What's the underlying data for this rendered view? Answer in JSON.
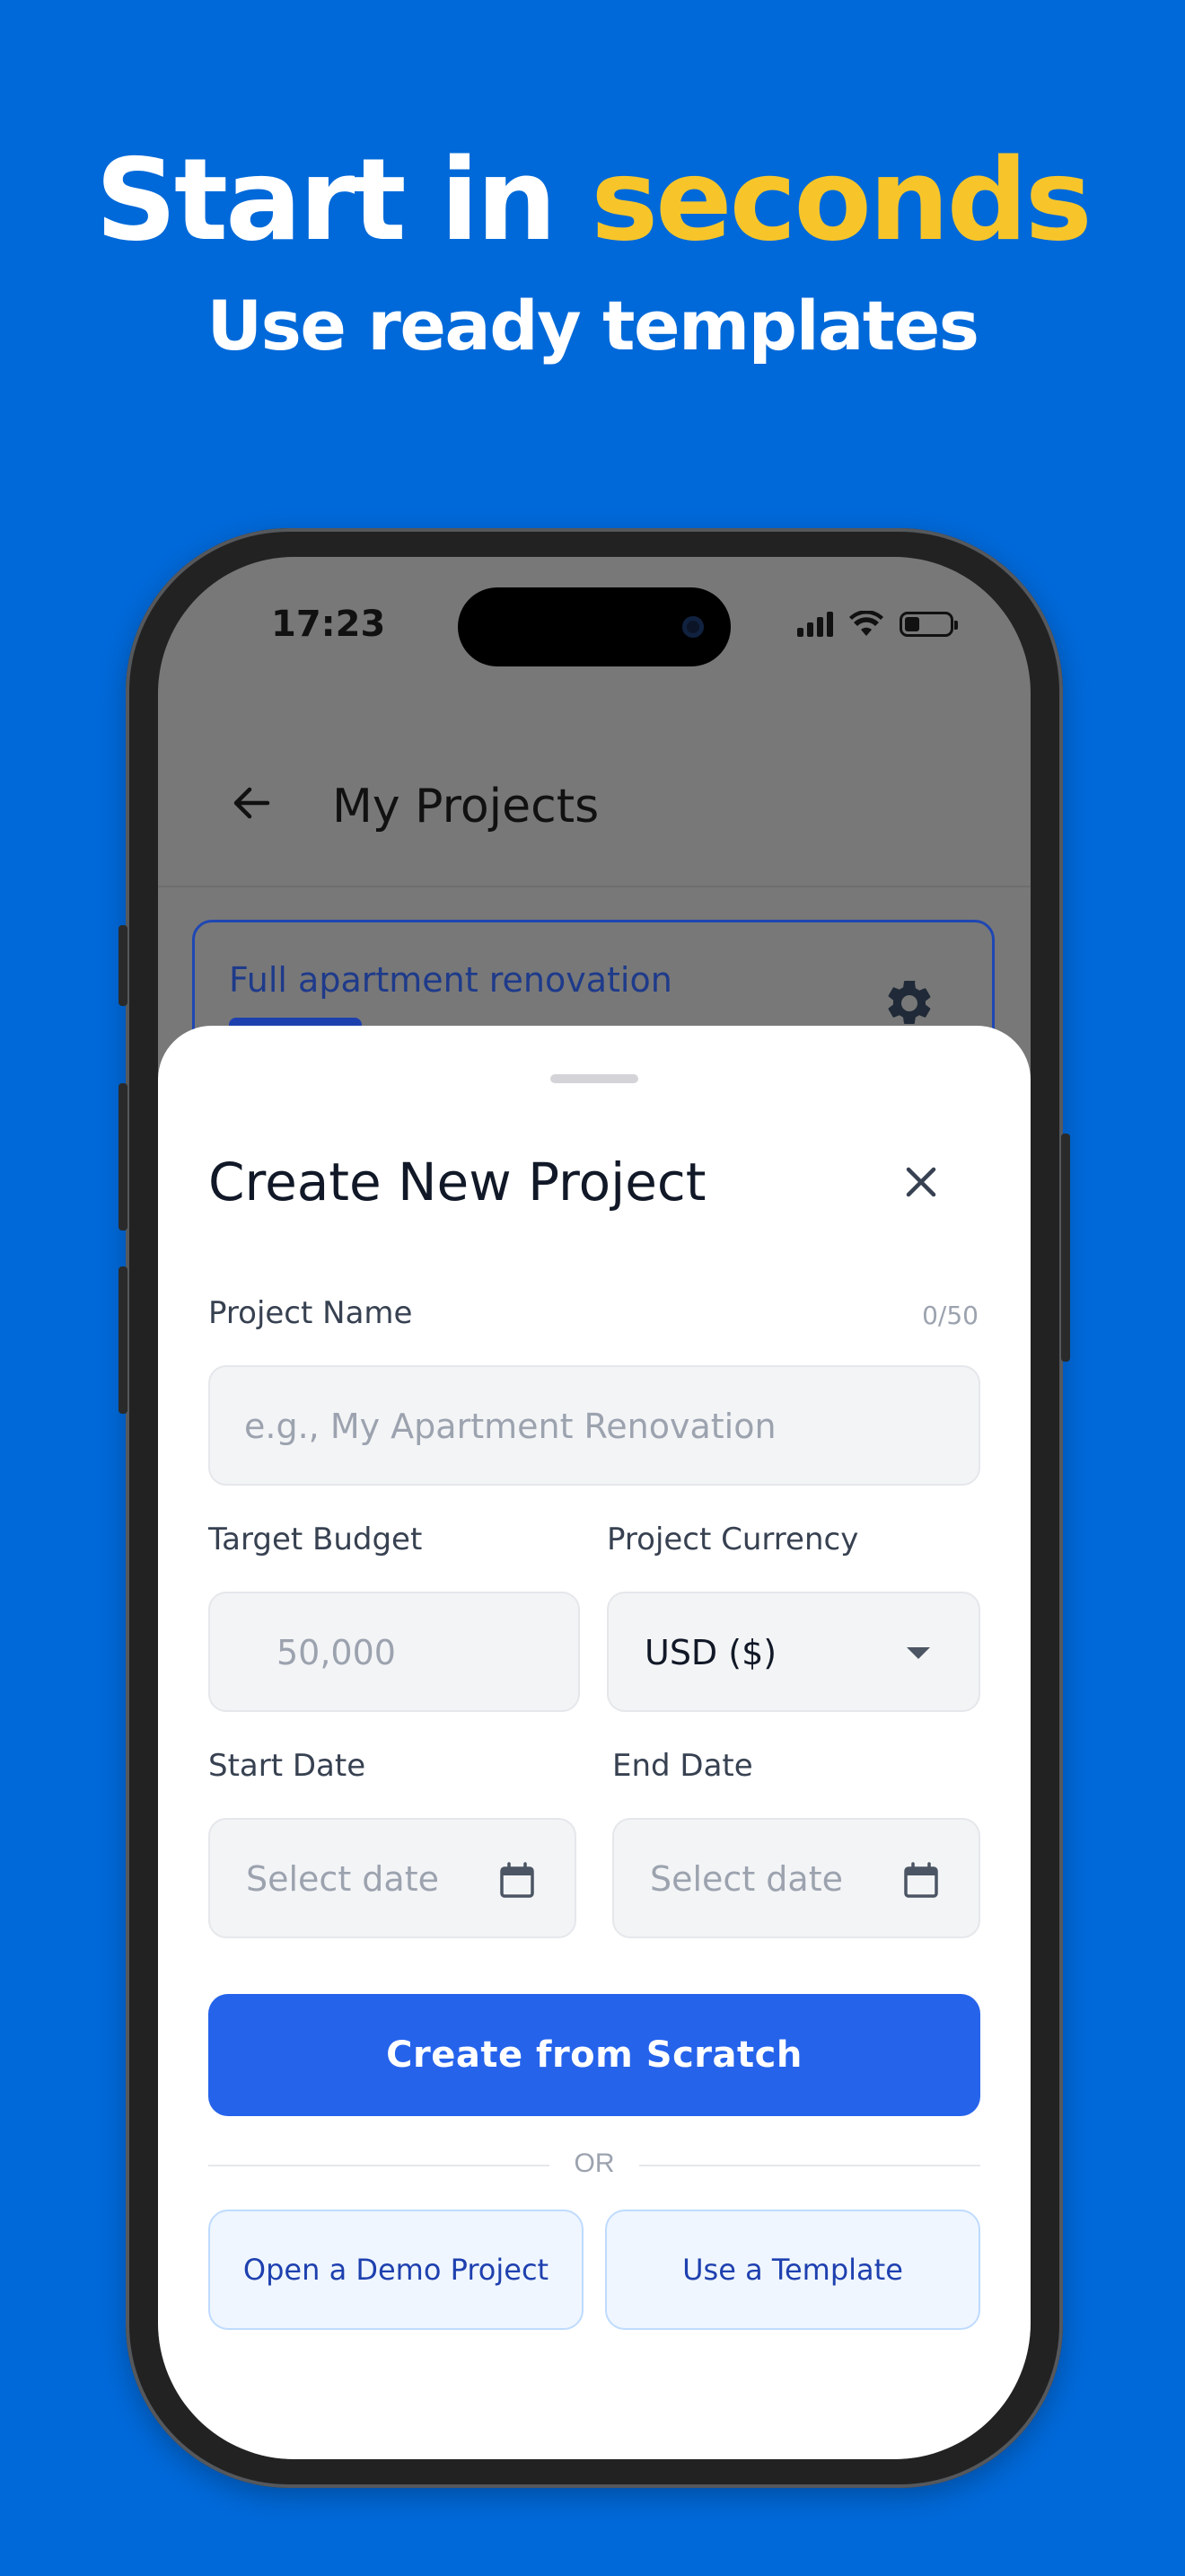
{
  "promo": {
    "headline_part1": "Start in ",
    "headline_part2": "seconds",
    "subhead": "Use ready templates",
    "accent_color": "#F7C52A",
    "background_color": "#0069D9"
  },
  "status_bar": {
    "time": "17:23"
  },
  "app_bar": {
    "title": "My Projects",
    "back_icon": "arrow-left-icon"
  },
  "project_card": {
    "title": "Full apartment renovation",
    "settings_icon": "gear-icon"
  },
  "sheet": {
    "title": "Create New Project",
    "close_icon": "close-icon",
    "project_name": {
      "label": "Project Name",
      "counter": "0/50",
      "placeholder": "e.g., My Apartment Renovation"
    },
    "target_budget": {
      "label": "Target Budget",
      "placeholder": "50,000"
    },
    "currency": {
      "label": "Project Currency",
      "value": "USD ($)"
    },
    "start_date": {
      "label": "Start Date",
      "placeholder": "Select date"
    },
    "end_date": {
      "label": "End Date",
      "placeholder": "Select date"
    },
    "create_button": "Create from Scratch",
    "or_text": "OR",
    "demo_button": "Open a Demo Project",
    "template_button": "Use a Template",
    "primary_color": "#2563EB"
  }
}
